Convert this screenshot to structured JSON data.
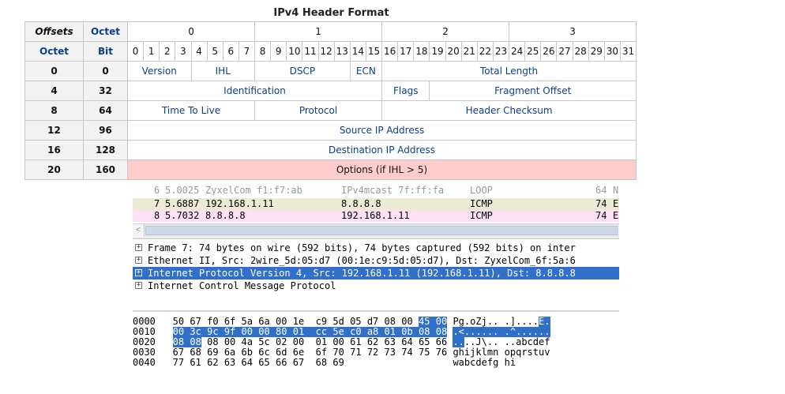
{
  "title": "IPv4 Header Format",
  "header_row1": {
    "offsets": "Offsets",
    "octet": "Octet",
    "groups": [
      "0",
      "1",
      "2",
      "3"
    ]
  },
  "header_row2": {
    "octet": "Octet",
    "bit": "Bit",
    "bits": [
      "0",
      "1",
      "2",
      "3",
      "4",
      "5",
      "6",
      "7",
      "8",
      "9",
      "10",
      "11",
      "12",
      "13",
      "14",
      "15",
      "16",
      "17",
      "18",
      "19",
      "20",
      "21",
      "22",
      "23",
      "24",
      "25",
      "26",
      "27",
      "28",
      "29",
      "30",
      "31"
    ]
  },
  "rows": [
    {
      "octet": "0",
      "bit": "0",
      "fields": [
        {
          "label": "Version",
          "span": 4
        },
        {
          "label": "IHL",
          "span": 4
        },
        {
          "label": "DSCP",
          "span": 6
        },
        {
          "label": "ECN",
          "span": 2
        },
        {
          "label": "Total Length",
          "span": 16
        }
      ]
    },
    {
      "octet": "4",
      "bit": "32",
      "fields": [
        {
          "label": "Identification",
          "span": 16
        },
        {
          "label": "Flags",
          "span": 3
        },
        {
          "label": "Fragment Offset",
          "span": 13
        }
      ]
    },
    {
      "octet": "8",
      "bit": "64",
      "fields": [
        {
          "label": "Time To Live",
          "span": 8
        },
        {
          "label": "Protocol",
          "span": 8
        },
        {
          "label": "Header Checksum",
          "span": 16
        }
      ]
    },
    {
      "octet": "12",
      "bit": "96",
      "fields": [
        {
          "label": "Source IP Address",
          "span": 32
        }
      ]
    },
    {
      "octet": "16",
      "bit": "128",
      "fields": [
        {
          "label": "Destination IP Address",
          "span": 32
        }
      ]
    },
    {
      "octet": "20",
      "bit": "160",
      "fields": [
        {
          "label": "Options (if IHL > 5)",
          "span": 32,
          "highlight": true
        }
      ]
    }
  ],
  "packet_list": [
    {
      "no": "6",
      "time": "5.0025",
      "src": "ZyxelCom_f1:f7:ab",
      "dst": "IPv4mcast_7f:ff:fa",
      "proto": "LOOP",
      "len": "64",
      "info": "N",
      "bg": "#ffffff",
      "faded": true
    },
    {
      "no": "7",
      "time": "5.6887",
      "src": "192.168.1.11",
      "dst": "8.8.8.8",
      "proto": "ICMP",
      "len": "74",
      "info": "E",
      "bg": "#ece9d4",
      "faded": false
    },
    {
      "no": "8",
      "time": "5.7032",
      "src": "8.8.8.8",
      "dst": "192.168.1.11",
      "proto": "ICMP",
      "len": "74",
      "info": "E",
      "bg": "#fce0f4",
      "faded": false
    }
  ],
  "details": [
    {
      "text": "Frame 7: 74 bytes on wire (592 bits), 74 bytes captured (592 bits) on inter",
      "selected": false
    },
    {
      "text": "Ethernet II, Src: 2wire_5d:05:d7 (00:1e:c9:5d:05:d7), Dst: ZyxelCom_6f:5a:6",
      "selected": false
    },
    {
      "text": "Internet Protocol Version 4, Src: 192.168.1.11 (192.168.1.11), Dst: 8.8.8.8",
      "selected": true
    },
    {
      "text": "Internet Control Message Protocol",
      "selected": false
    }
  ],
  "expander": "+",
  "scroll_left": "<",
  "hex_dump": [
    {
      "offset": "0000",
      "bytes": [
        "50",
        "67",
        "f0",
        "6f",
        "5a",
        "6a",
        "00",
        "1e",
        "c9",
        "5d",
        "05",
        "d7",
        "08",
        "00",
        "45",
        "00"
      ],
      "hl": [
        14,
        15
      ],
      "ascii": [
        "P",
        "g",
        ".",
        "o",
        "Z",
        "j",
        ".",
        ".",
        ".",
        "]",
        ".",
        ".",
        ".",
        ".",
        "E",
        "."
      ]
    },
    {
      "offset": "0010",
      "bytes": [
        "00",
        "3c",
        "9c",
        "9f",
        "00",
        "00",
        "80",
        "01",
        "cc",
        "5e",
        "c0",
        "a8",
        "01",
        "0b",
        "08",
        "08"
      ],
      "hl": [
        0,
        15
      ],
      "ascii": [
        ".",
        "<",
        ".",
        ".",
        ".",
        ".",
        ".",
        ".",
        ".",
        "^",
        ".",
        ".",
        ".",
        ".",
        ".",
        "."
      ]
    },
    {
      "offset": "0020",
      "bytes": [
        "08",
        "08",
        "08",
        "00",
        "4a",
        "5c",
        "02",
        "00",
        "01",
        "00",
        "61",
        "62",
        "63",
        "64",
        "65",
        "66"
      ],
      "hl": [
        0,
        1
      ],
      "ascii": [
        ".",
        ".",
        ".",
        ".",
        "J",
        "\\",
        ".",
        ".",
        ".",
        ".",
        "a",
        "b",
        "c",
        "d",
        "e",
        "f"
      ]
    },
    {
      "offset": "0030",
      "bytes": [
        "67",
        "68",
        "69",
        "6a",
        "6b",
        "6c",
        "6d",
        "6e",
        "6f",
        "70",
        "71",
        "72",
        "73",
        "74",
        "75",
        "76"
      ],
      "hl": null,
      "ascii": [
        "g",
        "h",
        "i",
        "j",
        "k",
        "l",
        "m",
        "n",
        "o",
        "p",
        "q",
        "r",
        "s",
        "t",
        "u",
        "v"
      ]
    },
    {
      "offset": "0040",
      "bytes": [
        "77",
        "61",
        "62",
        "63",
        "64",
        "65",
        "66",
        "67",
        "68",
        "69"
      ],
      "hl": null,
      "ascii": [
        "w",
        "a",
        "b",
        "c",
        "d",
        "e",
        "f",
        "g",
        "h",
        "i"
      ]
    }
  ],
  "colors": {
    "selection": "#3070c8",
    "options_bg": "#ffcccc",
    "field_text": "#0b3f8a"
  }
}
